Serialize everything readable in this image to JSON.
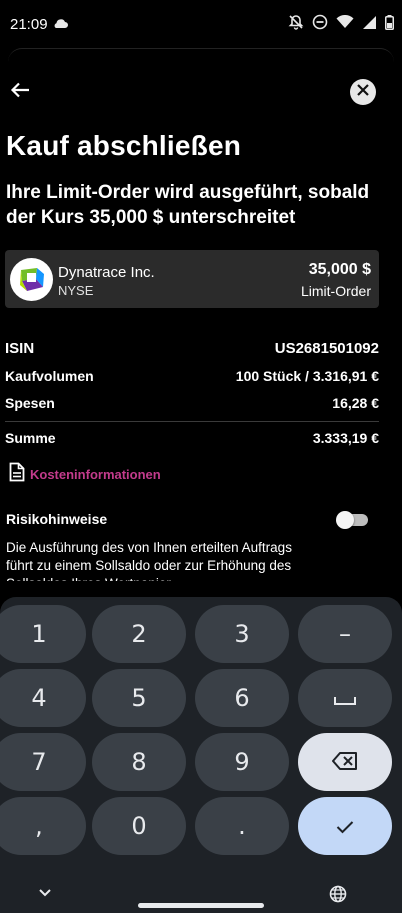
{
  "status": {
    "time": "21:09",
    "icons": [
      "cloud-icon",
      "notifications-off-icon",
      "do-not-disturb-icon",
      "wifi-icon",
      "signal-icon",
      "battery-icon"
    ]
  },
  "header": {
    "back_icon": "arrow-left-icon",
    "close_icon": "close-icon"
  },
  "page": {
    "title": "Kauf abschließen",
    "subtitle": "Ihre Limit-Order wird ausgeführt, sobald der Kurs 35,000 $ unterschreitet"
  },
  "stock": {
    "name": "Dynatrace Inc.",
    "exchange": "NYSE",
    "price": "35,000 $",
    "order_type": "Limit-Order"
  },
  "details": {
    "isin_label": "ISIN",
    "isin_value": "US2681501092",
    "volume_label": "Kaufvolumen",
    "volume_value": "100 Stück / 3.316,91 €",
    "fees_label": "Spesen",
    "fees_value": "16,28 €",
    "sum_label": "Summe",
    "sum_value": "3.333,19 €"
  },
  "cost_link": {
    "label": "Kosteninformationen",
    "icon": "document-icon"
  },
  "risk": {
    "title": "Risikohinweise",
    "text": "Die Ausführung des von Ihnen erteilten Auftrags führt zu einem Sollsaldo oder zur Erhöhung des Sollsaldos Ihres Wertpapier-",
    "toggle_on": false
  },
  "keyboard": {
    "keys": [
      [
        "1",
        "2",
        "3",
        "–"
      ],
      [
        "4",
        "5",
        "6",
        "␣"
      ],
      [
        "7",
        "8",
        "9",
        "⌫"
      ],
      [
        ",",
        "0",
        ".",
        "✓"
      ]
    ]
  },
  "nav": {
    "hide_icon": "chevron-down-icon",
    "globe_icon": "globe-icon"
  },
  "colors": {
    "background": "#000000",
    "card": "#2b2b2b",
    "link": "#c33b8c",
    "keyboard_bg": "#1e2227",
    "key_bg": "#3a4047",
    "confirm_key": "#c3d8f7"
  }
}
